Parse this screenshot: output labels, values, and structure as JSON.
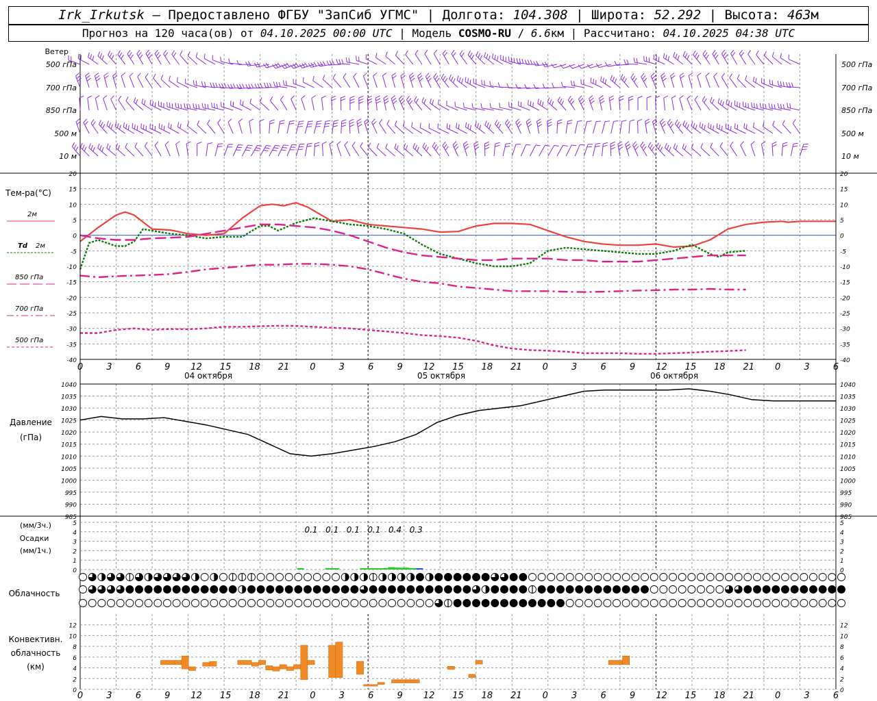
{
  "header": {
    "station": "Irk_Irkutsk",
    "provider": " — Предоставлено ФГБУ \"ЗапСиб УГМС\" | Долгота: ",
    "lon": "104.308",
    "lat_label": " | Широта: ",
    "lat": "52.292",
    "alt_label": " | Высота: ",
    "alt": "463",
    "alt_unit": "м",
    "forecast_label": "Прогноз на 120 часа(ов) от ",
    "forecast_date": "04.10.2025 00:00 UTC",
    "model_label": " | Модель ",
    "model": "COSMO-RU",
    "res_sep": " / ",
    "resolution": "6.6",
    "res_unit": "км",
    "calc_label": " | Рассчитано: ",
    "calc_date": "04.10.2025 04:38 UTC"
  },
  "colors": {
    "wind": "#8a2be2",
    "t2m": "#f04040",
    "td2m": "#0a7a0a",
    "t850": "#e0208a",
    "t700": "#e0208a",
    "t500": "#e0208a",
    "pressure": "#000000",
    "precip_green": "#22cc22",
    "precip_blue": "#2255dd",
    "convective": "#f08a24",
    "grid": "#999999"
  },
  "chart_data": [
    {
      "type": "wind-barbs",
      "title": "Ветер",
      "levels": [
        "500 гПа",
        "700 гПа",
        "850 гПа",
        "500 м",
        "10 м"
      ]
    },
    {
      "type": "line",
      "title": "Тем-ра(°C)",
      "ylim": [
        -40,
        20
      ],
      "yticks": [
        20,
        15,
        10,
        5,
        0,
        -5,
        -10,
        -15,
        -20,
        -25,
        -30,
        -35,
        -40
      ],
      "x_hours": [
        0,
        6,
        12,
        18,
        24,
        30,
        36,
        42,
        48,
        54,
        60,
        66,
        72,
        78,
        84,
        90,
        96,
        102,
        108,
        114,
        120,
        126,
        132,
        138,
        144,
        150
      ],
      "xtick_labels": [
        "0",
        "3",
        "6",
        "9",
        "12",
        "15",
        "18",
        "21",
        "0",
        "3",
        "6",
        "9",
        "12",
        "15",
        "18",
        "21",
        "0",
        "3",
        "6",
        "9",
        "12",
        "15",
        "18",
        "21",
        "0",
        "3",
        "6"
      ],
      "day_labels": [
        "04 октября",
        "05 октября",
        "06 октября"
      ],
      "series": [
        {
          "name": "2м",
          "style": "solid",
          "x": [
            0,
            3,
            6,
            7.5,
            9,
            12,
            15,
            18,
            21,
            24,
            27,
            30,
            32,
            34,
            36,
            38,
            42,
            45,
            48,
            51,
            54,
            57,
            60,
            63,
            66,
            69,
            72,
            75,
            78,
            81,
            84,
            87,
            90,
            93,
            96,
            99,
            102,
            105,
            108,
            111,
            114,
            117,
            118,
            120,
            123,
            126
          ],
          "y": [
            -2,
            2.5,
            6.5,
            7.5,
            6.5,
            2,
            1.7,
            0.5,
            0,
            0.5,
            5.5,
            9.5,
            10,
            9.5,
            10.5,
            9,
            4.5,
            5,
            3.5,
            3,
            2.5,
            2,
            1,
            1.2,
            3,
            3.8,
            3.8,
            3.5,
            1.5,
            -0.5,
            -2,
            -2.8,
            -3.2,
            -3.2,
            -2.8,
            -3.8,
            -3.5,
            -1.5,
            2,
            3.5,
            4.2,
            4.5,
            4.2,
            4.5,
            4.5,
            4.5
          ]
        },
        {
          "name": "Td 2м",
          "style": "dotted",
          "x": [
            0,
            1.5,
            3,
            4.5,
            6,
            7.5,
            9,
            10.5,
            12,
            15,
            18,
            21,
            24,
            27,
            30,
            31.5,
            33,
            36,
            39,
            42,
            45,
            48,
            51,
            54,
            57,
            60,
            63,
            66,
            69,
            72,
            75,
            78,
            81,
            84,
            87,
            90,
            93,
            96,
            99,
            102,
            105,
            106.5,
            108,
            111
          ],
          "y": [
            -11,
            -2.5,
            -1.5,
            -2.5,
            -3.5,
            -3.5,
            -2,
            2,
            1.5,
            0.5,
            0,
            -1,
            -0.5,
            -0.5,
            3,
            3,
            1.5,
            4,
            5.5,
            4.5,
            3.5,
            3,
            2,
            0.5,
            -3,
            -6,
            -7.5,
            -9,
            -10,
            -10,
            -9,
            -5,
            -4,
            -4.5,
            -5,
            -5.5,
            -6,
            -6,
            -5,
            -3,
            -6,
            -7,
            -5.5,
            -5
          ]
        },
        {
          "name": "850 гПа",
          "style": "longdash",
          "x": [
            0,
            3,
            6,
            9,
            12,
            15,
            18,
            21,
            24,
            27,
            30,
            33,
            36,
            39,
            42,
            45,
            48,
            51,
            54,
            57,
            60,
            63,
            66,
            69,
            72,
            75,
            78,
            81,
            84,
            87,
            90,
            93,
            96,
            99,
            102,
            105,
            108,
            111
          ],
          "y": [
            0,
            -1,
            -1.5,
            -1.5,
            -1,
            -0.8,
            -0.5,
            0.5,
            1.5,
            2.5,
            3.5,
            3.5,
            3,
            2.5,
            1.5,
            0,
            -2,
            -4,
            -5.5,
            -6.5,
            -7,
            -7.5,
            -8,
            -8,
            -7.5,
            -7.5,
            -7.5,
            -8,
            -8,
            -8.5,
            -8.5,
            -8.5,
            -8,
            -7.5,
            -7,
            -6.5,
            -6.5,
            -6.5
          ]
        },
        {
          "name": "700 гПа",
          "style": "dashdot",
          "x": [
            0,
            3,
            6,
            9,
            12,
            15,
            18,
            21,
            24,
            27,
            30,
            33,
            36,
            39,
            42,
            45,
            48,
            51,
            54,
            57,
            60,
            63,
            66,
            69,
            72,
            75,
            78,
            81,
            84,
            87,
            90,
            93,
            96,
            99,
            102,
            105,
            108,
            111
          ],
          "y": [
            -13,
            -13.5,
            -13.2,
            -13,
            -12.8,
            -12.5,
            -11.8,
            -11,
            -10.5,
            -10,
            -9.5,
            -9.5,
            -9.2,
            -9.2,
            -9.5,
            -10,
            -11,
            -12.5,
            -14,
            -15,
            -15.5,
            -16.5,
            -17,
            -17.5,
            -18,
            -18,
            -18,
            -18.2,
            -18.3,
            -18.2,
            -18,
            -17.8,
            -17.7,
            -17.5,
            -17.5,
            -17.3,
            -17.5,
            -17.5
          ]
        },
        {
          "name": "500 гПа",
          "style": "shortdash",
          "x": [
            0,
            3,
            6,
            9,
            12,
            15,
            18,
            21,
            24,
            27,
            30,
            33,
            36,
            39,
            42,
            45,
            48,
            51,
            54,
            57,
            60,
            63,
            66,
            69,
            72,
            75,
            78,
            81,
            84,
            87,
            90,
            93,
            96,
            99,
            102,
            105,
            108,
            111
          ],
          "y": [
            -31.5,
            -31.5,
            -30.5,
            -30,
            -30.5,
            -30.2,
            -30.3,
            -30,
            -29.5,
            -29.5,
            -29.3,
            -29.2,
            -29.2,
            -29.5,
            -29.8,
            -30,
            -30.5,
            -31,
            -31.5,
            -32.2,
            -32.5,
            -33,
            -34,
            -35.5,
            -36.5,
            -37,
            -37.2,
            -37.5,
            -38,
            -38,
            -38,
            -38.2,
            -38.2,
            -38,
            -37.8,
            -37.5,
            -37.3,
            -37
          ]
        }
      ]
    },
    {
      "type": "line",
      "title": "Давление",
      "ylabel": "(гПа)",
      "ylim": [
        985,
        1040
      ],
      "yticks": [
        1040,
        1035,
        1030,
        1025,
        1020,
        1015,
        1010,
        1005,
        1000,
        995,
        990,
        985
      ],
      "series": [
        {
          "name": "",
          "x": [
            0,
            3,
            6,
            9,
            12,
            15,
            18,
            21,
            24,
            27,
            30,
            33,
            36,
            39,
            42,
            45,
            48,
            51,
            54,
            57,
            60,
            63,
            66,
            69,
            72,
            75,
            78,
            81,
            84,
            87,
            90,
            93,
            96,
            99,
            102,
            105,
            108
          ],
          "y": [
            1025,
            1026.5,
            1025.5,
            1025.5,
            1026,
            1024.5,
            1023,
            1021,
            1019,
            1015,
            1011,
            1010,
            1011,
            1012.5,
            1014,
            1016,
            1019,
            1024,
            1027,
            1029,
            1030,
            1031,
            1033,
            1035,
            1037,
            1037.5,
            1037.5,
            1037.5,
            1037.5,
            1038,
            1037,
            1035.5,
            1033.5,
            1033,
            1033,
            1033,
            1033
          ]
        }
      ]
    },
    {
      "type": "bar",
      "title": "Осадки",
      "ylabels": [
        "(мм/3ч.)",
        "(мм/1ч.)"
      ],
      "ylim": [
        0,
        5
      ],
      "yticks": [
        5,
        4,
        3,
        2,
        1,
        0
      ],
      "labels": [
        {
          "x": 33,
          "text": "0.1"
        },
        {
          "x": 36,
          "text": "0.1"
        },
        {
          "x": 39,
          "text": "0.1"
        },
        {
          "x": 42,
          "text": "0.1"
        },
        {
          "x": 45,
          "text": "0.4"
        },
        {
          "x": 48,
          "text": "0.3"
        }
      ],
      "bars": [
        {
          "x": 31.5,
          "value": 0.08,
          "color": "green"
        },
        {
          "x": 35.5,
          "value": 0.08,
          "color": "green"
        },
        {
          "x": 36.5,
          "value": 0.08,
          "color": "green"
        },
        {
          "x": 40.5,
          "value": 0.05,
          "color": "green"
        },
        {
          "x": 41.5,
          "value": 0.1,
          "color": "green"
        },
        {
          "x": 42.5,
          "value": 0.12,
          "color": "green"
        },
        {
          "x": 43.5,
          "value": 0.12,
          "color": "green"
        },
        {
          "x": 44.5,
          "value": 0.25,
          "color": "green"
        },
        {
          "x": 45.5,
          "value": 0.2,
          "color": "green"
        },
        {
          "x": 46.5,
          "value": 0.2,
          "color": "green"
        },
        {
          "x": 47.5,
          "value": 0.15,
          "color": "green"
        },
        {
          "x": 48.5,
          "value": 0.12,
          "color": "blue"
        }
      ]
    },
    {
      "type": "table",
      "title": "Облачность",
      "rows": [
        "0323313233332020111000000000222122224244444433440000000000000000000000000000000000",
        "0333344444444444424444444444443444444444443244441444444444444000000003344444444444",
        "0000000000000000000000000000000000000031444444444444000000000000000000000000000000"
      ]
    },
    {
      "type": "bar",
      "title": "Конвективн. облачность",
      "ylabel": "(км)",
      "ylim": [
        0,
        14
      ],
      "yticks": [
        0,
        2,
        4,
        6,
        8,
        10,
        12
      ],
      "bars": [
        {
          "x0": 11.5,
          "x1": 13.5,
          "bottom": 4.6,
          "top": 5.4
        },
        {
          "x0": 13.5,
          "x1": 14.5,
          "bottom": 4.6,
          "top": 5.4
        },
        {
          "x0": 14.5,
          "x1": 15.5,
          "bottom": 3.8,
          "top": 6.2
        },
        {
          "x0": 15.5,
          "x1": 16.5,
          "bottom": 3.5,
          "top": 4.2
        },
        {
          "x0": 17.5,
          "x1": 18.5,
          "bottom": 4.3,
          "top": 5.0
        },
        {
          "x0": 18.5,
          "x1": 19.5,
          "bottom": 4.3,
          "top": 5.2
        },
        {
          "x0": 22.5,
          "x1": 24.5,
          "bottom": 4.6,
          "top": 5.4
        },
        {
          "x0": 24.5,
          "x1": 25.5,
          "bottom": 4.3,
          "top": 5.0
        },
        {
          "x0": 25.5,
          "x1": 26.5,
          "bottom": 4.6,
          "top": 5.4
        },
        {
          "x0": 26.5,
          "x1": 27.5,
          "bottom": 3.6,
          "top": 4.4
        },
        {
          "x0": 27.5,
          "x1": 28.5,
          "bottom": 3.4,
          "top": 4.2
        },
        {
          "x0": 28.5,
          "x1": 29.5,
          "bottom": 3.8,
          "top": 4.6
        },
        {
          "x0": 29.5,
          "x1": 30.5,
          "bottom": 3.5,
          "top": 4.2
        },
        {
          "x0": 30.5,
          "x1": 31.5,
          "bottom": 3.8,
          "top": 4.6
        },
        {
          "x0": 31.5,
          "x1": 32.5,
          "bottom": 1.8,
          "top": 8.2
        },
        {
          "x0": 32.5,
          "x1": 33.5,
          "bottom": 4.6,
          "top": 5.4
        },
        {
          "x0": 35.5,
          "x1": 36.5,
          "bottom": 2.2,
          "top": 8.2
        },
        {
          "x0": 36.5,
          "x1": 37.5,
          "bottom": 2.2,
          "top": 8.8
        },
        {
          "x0": 39.5,
          "x1": 40.5,
          "bottom": 2.8,
          "top": 5.2
        },
        {
          "x0": 40.5,
          "x1": 42.5,
          "bottom": 0.6,
          "top": 0.9
        },
        {
          "x0": 42.5,
          "x1": 43.5,
          "bottom": 0.9,
          "top": 1.3
        },
        {
          "x0": 44.5,
          "x1": 46.5,
          "bottom": 1.2,
          "top": 1.8
        },
        {
          "x0": 46.5,
          "x1": 48.5,
          "bottom": 1.2,
          "top": 1.8
        },
        {
          "x0": 52.5,
          "x1": 53.5,
          "bottom": 3.7,
          "top": 4.3
        },
        {
          "x0": 55.5,
          "x1": 56.5,
          "bottom": 2.2,
          "top": 2.8
        },
        {
          "x0": 56.5,
          "x1": 57.5,
          "bottom": 4.7,
          "top": 5.4
        },
        {
          "x0": 75.5,
          "x1": 77.5,
          "bottom": 4.6,
          "top": 5.4
        },
        {
          "x0": 77.5,
          "x1": 78.5,
          "bottom": 4.6,
          "top": 6.2
        }
      ]
    }
  ],
  "wind_labels": [
    "Ветер",
    "500 гПа",
    "700 гПа",
    "850 гПа",
    "500 м",
    "10 м"
  ],
  "temp_labels": {
    "title": "Тем-ра(°C)",
    "t2m": "2м",
    "td": "Td",
    "td2m": "2м",
    "t850": "850 гПа",
    "t700": "700 гПа",
    "t500": "500 гПа"
  },
  "pressure_labels": {
    "title": "Давление",
    "unit": "(гПа)"
  },
  "precip_labels": {
    "unit3": "(мм/3ч.)",
    "title": "Осадки",
    "unit1": "(мм/1ч.)"
  },
  "cloud_label": "Облачность",
  "conv_labels": {
    "line1": "Конвективн.",
    "line2": "облачность",
    "unit": "(км)"
  }
}
